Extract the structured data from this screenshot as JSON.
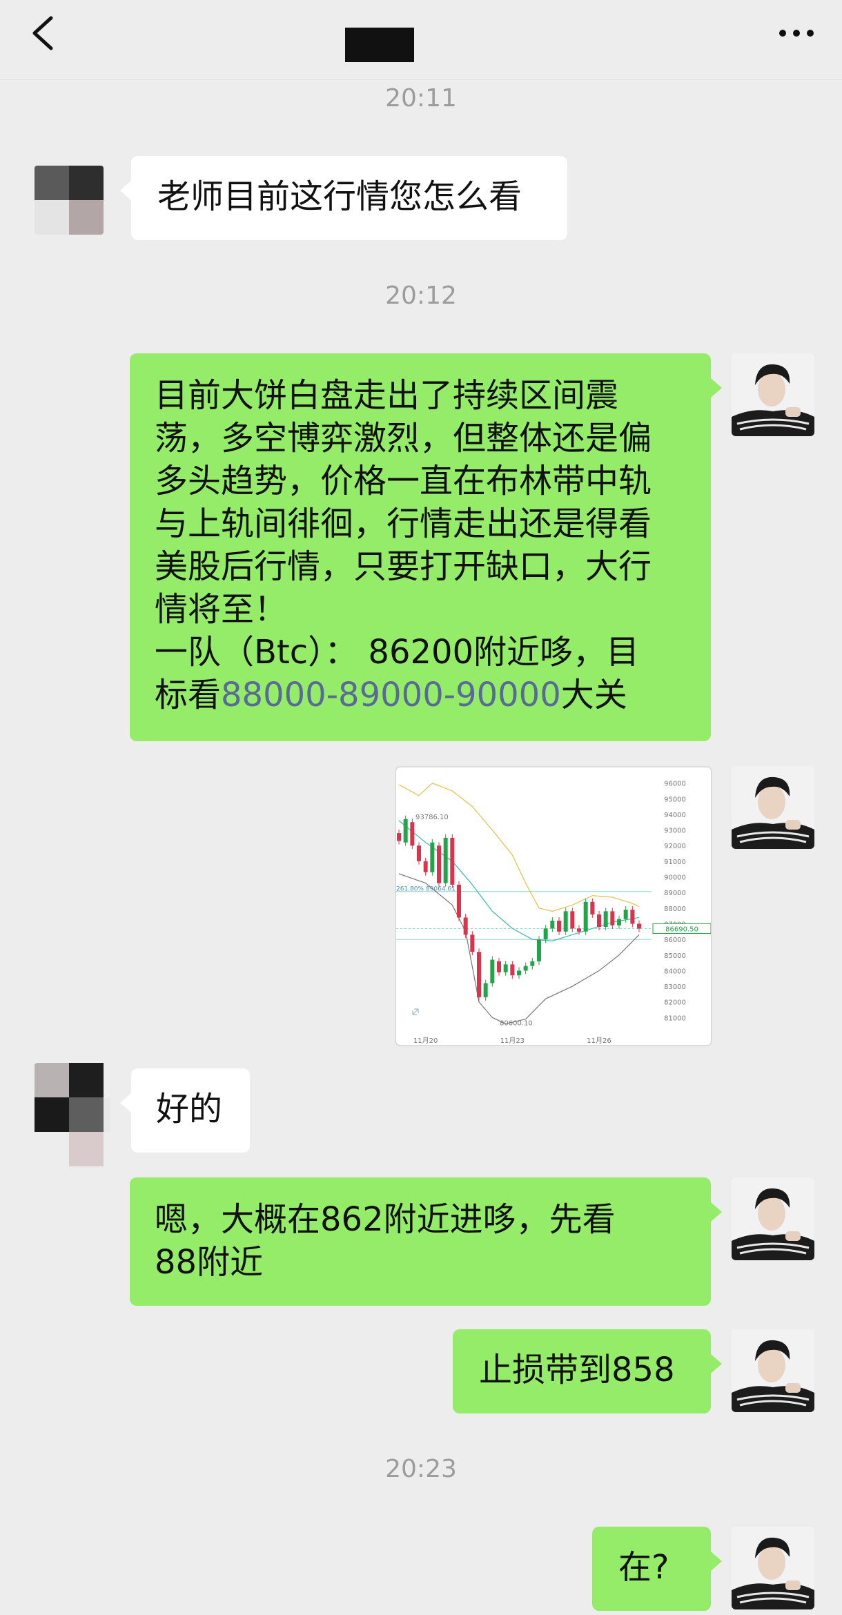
{
  "header": {
    "title_redacted": true
  },
  "timestamps": {
    "t1": "20:11",
    "t2": "20:12",
    "t3": "20:23"
  },
  "messages": {
    "m1": "老师目前这行情您怎么看",
    "m2_lines": [
      "目前大饼白盘走出了持续区间震",
      "荡，多空博弈激烈，但整体还是偏",
      "多头趋势，价格一直在布林带中轨",
      "与上轨间徘徊，行情走出还是得看",
      "美股后行情，只要打开缺口，大行",
      "情将至！",
      "一队（Btc）： 86200附近哆，目"
    ],
    "m2_last_prefix": "标看",
    "m2_last_link": "88000-89000-90000",
    "m2_last_suffix": "大关",
    "m3": "好的",
    "m4_line1": "嗯，大概在862附近进哆，先看",
    "m4_line2": "88附近",
    "m5": "止损带到858",
    "m6": "在?"
  },
  "chart_data": {
    "type": "candlestick",
    "yticks": [
      "96000",
      "95000",
      "94000",
      "93000",
      "92000",
      "91000",
      "90000",
      "89000",
      "88000",
      "87000",
      "86000",
      "85000",
      "84000",
      "83000",
      "82000",
      "81000"
    ],
    "xticks": [
      "11月20",
      "11月23",
      "11月26"
    ],
    "annotations": {
      "high": "93786.10",
      "low": "80600.10",
      "fib": "261.80% 89064.61",
      "price": "86690.50"
    },
    "candles": [
      {
        "o": 92800,
        "c": 92300
      },
      {
        "o": 92200,
        "c": 93700
      },
      {
        "o": 93500,
        "c": 92000
      },
      {
        "o": 92000,
        "c": 91000
      },
      {
        "o": 91000,
        "c": 90300
      },
      {
        "o": 90300,
        "c": 92200
      },
      {
        "o": 92000,
        "c": 89600
      },
      {
        "o": 89600,
        "c": 92500
      },
      {
        "o": 92500,
        "c": 89500
      },
      {
        "o": 89500,
        "c": 87400
      },
      {
        "o": 87400,
        "c": 86300
      },
      {
        "o": 86300,
        "c": 85200
      },
      {
        "o": 85200,
        "c": 82300
      },
      {
        "o": 82300,
        "c": 83200
      },
      {
        "o": 83200,
        "c": 84700
      },
      {
        "o": 84600,
        "c": 83900
      },
      {
        "o": 83900,
        "c": 84400
      },
      {
        "o": 84400,
        "c": 83700
      },
      {
        "o": 83700,
        "c": 84000
      },
      {
        "o": 84000,
        "c": 84300
      },
      {
        "o": 84300,
        "c": 84600
      },
      {
        "o": 84600,
        "c": 86000
      },
      {
        "o": 86000,
        "c": 86700
      },
      {
        "o": 86700,
        "c": 87200
      },
      {
        "o": 87200,
        "c": 86500
      },
      {
        "o": 86500,
        "c": 87800
      },
      {
        "o": 87800,
        "c": 86700
      },
      {
        "o": 86700,
        "c": 86500
      },
      {
        "o": 86500,
        "c": 88400
      },
      {
        "o": 88400,
        "c": 87600
      },
      {
        "o": 87600,
        "c": 86800
      },
      {
        "o": 86800,
        "c": 87800
      },
      {
        "o": 87800,
        "c": 86900
      },
      {
        "o": 86900,
        "c": 87300
      },
      {
        "o": 87300,
        "c": 87900
      },
      {
        "o": 87900,
        "c": 87000
      },
      {
        "o": 87000,
        "c": 86690
      }
    ],
    "upper_band": [
      {
        "i": 0,
        "v": 95900
      },
      {
        "i": 3,
        "v": 95200
      },
      {
        "i": 5,
        "v": 96000
      },
      {
        "i": 8,
        "v": 95500
      },
      {
        "i": 11,
        "v": 94500
      },
      {
        "i": 14,
        "v": 93000
      },
      {
        "i": 17,
        "v": 91400
      },
      {
        "i": 19,
        "v": 89600
      },
      {
        "i": 21,
        "v": 88000
      },
      {
        "i": 23,
        "v": 87800
      },
      {
        "i": 26,
        "v": 88200
      },
      {
        "i": 29,
        "v": 88800
      },
      {
        "i": 32,
        "v": 88700
      },
      {
        "i": 35,
        "v": 88300
      },
      {
        "i": 36,
        "v": 88100
      }
    ],
    "middle_band": [
      {
        "i": 0,
        "v": 93600
      },
      {
        "i": 4,
        "v": 92200
      },
      {
        "i": 8,
        "v": 91000
      },
      {
        "i": 11,
        "v": 89500
      },
      {
        "i": 14,
        "v": 87800
      },
      {
        "i": 17,
        "v": 86700
      },
      {
        "i": 20,
        "v": 86000
      },
      {
        "i": 23,
        "v": 85900
      },
      {
        "i": 26,
        "v": 86300
      },
      {
        "i": 29,
        "v": 86700
      },
      {
        "i": 32,
        "v": 87100
      },
      {
        "i": 36,
        "v": 87400
      }
    ],
    "lower_band": [
      {
        "i": 0,
        "v": 90200
      },
      {
        "i": 4,
        "v": 89600
      },
      {
        "i": 8,
        "v": 88200
      },
      {
        "i": 10,
        "v": 86500
      },
      {
        "i": 12,
        "v": 82000
      },
      {
        "i": 14,
        "v": 81000
      },
      {
        "i": 16,
        "v": 80600
      },
      {
        "i": 19,
        "v": 80900
      },
      {
        "i": 22,
        "v": 82200
      },
      {
        "i": 26,
        "v": 83000
      },
      {
        "i": 30,
        "v": 84000
      },
      {
        "i": 33,
        "v": 85000
      },
      {
        "i": 36,
        "v": 86300
      }
    ],
    "hlines": [
      89064.61,
      86690.5,
      86000
    ],
    "colors": {
      "up": "#23a34a",
      "down": "#d9344d",
      "upper": "#e0c24a",
      "middle": "#3bb8b0",
      "lower": "#777777",
      "fib": "#8fd3cf"
    }
  },
  "theme": {
    "bubble_out": "#95ec69",
    "bubble_in": "#ffffff",
    "bg": "#ededed",
    "link": "#576b95"
  }
}
